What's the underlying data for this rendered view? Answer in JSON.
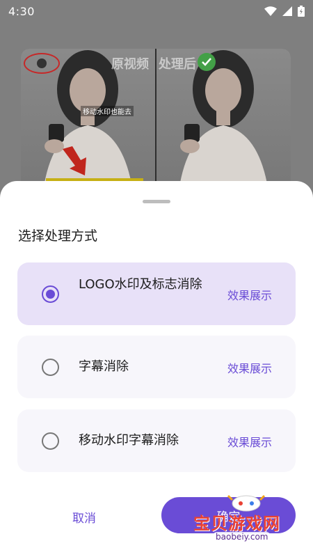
{
  "status_bar": {
    "time": "4:30"
  },
  "preview": {
    "left_label": "原视频",
    "right_label": "处理后",
    "caption": "移动水印也能去"
  },
  "sheet": {
    "title": "选择处理方式",
    "options": [
      {
        "label": "LOGO水印及标志消除",
        "link": "效果展示",
        "selected": true
      },
      {
        "label": "字幕消除",
        "link": "效果展示",
        "selected": false
      },
      {
        "label": "移动水印字幕消除",
        "link": "效果展示",
        "selected": false
      }
    ],
    "cancel_label": "取消",
    "confirm_label": "确定"
  },
  "watermark": {
    "text": "宝贝游戏网",
    "url": "baobeiy.com"
  },
  "colors": {
    "accent": "#6a4cd6",
    "selected_bg": "#e8e1f8",
    "option_bg": "#f7f6fb",
    "scrim": "#7f7f7f"
  }
}
